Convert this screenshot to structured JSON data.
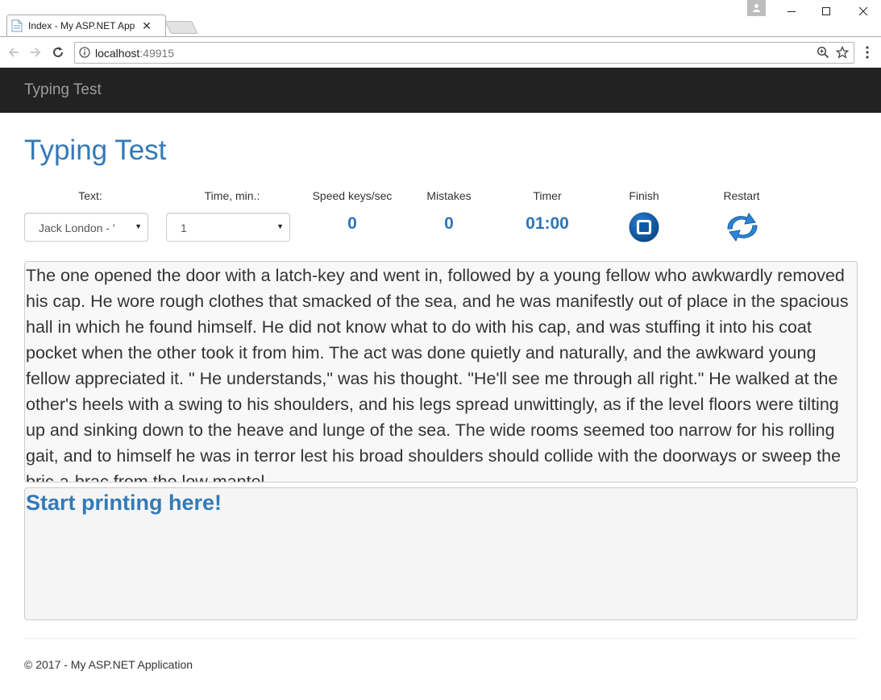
{
  "browser": {
    "tab_title": "Index - My ASP.NET Appli",
    "tab_close": "✕",
    "url_host": "localhost",
    "url_port": ":49915"
  },
  "navbar": {
    "brand": "Typing Test"
  },
  "page": {
    "title": "Typing Test"
  },
  "controls": {
    "text_label": "Text:",
    "text_selected": "Jack London - '",
    "time_label": "Time, min.:",
    "time_selected": "1",
    "speed_label": "Speed keys/sec",
    "speed_value": "0",
    "mistakes_label": "Mistakes",
    "mistakes_value": "0",
    "timer_label": "Timer",
    "timer_value": "01:00",
    "finish_label": "Finish",
    "restart_label": "Restart"
  },
  "passage": "The one opened the door with a latch-key and went in, followed by a young fellow who awkwardly removed his cap. He wore rough clothes that smacked of the sea, and he was manifestly out of place in the spacious hall in which he found himself. He did not know what to do with his cap, and was stuffing it into his coat pocket when the other took it from him. The act was done quietly and naturally, and the awkward young fellow appreciated it. \" He understands,\" was his thought. \"He'll see me through all right.\" He walked at the other's heels with a swing to his shoulders, and his legs spread unwittingly, as if the level floors were tilting up and sinking down to the heave and lunge of the sea. The wide rooms seemed too narrow for his rolling gait, and to himself he was in terror lest his broad shoulders should collide with the doorways or sweep the bric-a-brac from the low mantel.",
  "input_prompt": "Start printing here!",
  "footer": "© 2017 - My ASP.NET Application",
  "colors": {
    "accent": "#337ab7",
    "navbar": "#222222",
    "stat": "#2e75b6"
  }
}
